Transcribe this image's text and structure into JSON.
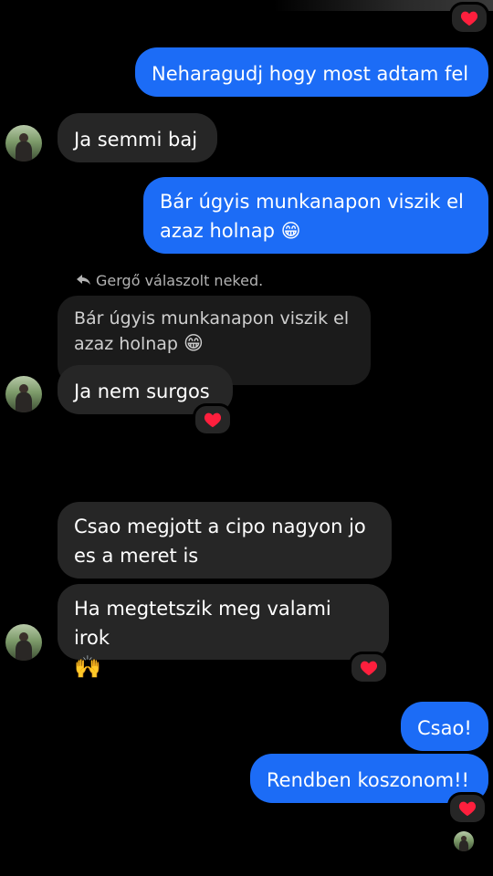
{
  "conversation": {
    "messages": [
      {
        "id": "m1",
        "side": "out",
        "text": "Neharagudj hogy most adtam fel"
      },
      {
        "id": "m2",
        "side": "in",
        "text": "Ja semmi baj"
      },
      {
        "id": "m3",
        "side": "out",
        "text": "Bár úgyis munkanapon viszik el azaz holnap",
        "emoji": "😁"
      },
      {
        "id": "m4",
        "side": "in",
        "reply_label": "Gergő válaszolt neked.",
        "quoted_text": "Bár úgyis munkanapon viszik el azaz holnap",
        "quoted_emoji": "😁",
        "text": "Ja nem surgos",
        "reaction": "heart"
      },
      {
        "id": "m5",
        "side": "in",
        "text": "Csao megjott a cipo nagyon jo es a meret is"
      },
      {
        "id": "m6",
        "side": "in",
        "text": "Ha megtetszik meg valami irok",
        "emoji": "🙌",
        "reaction": "heart"
      },
      {
        "id": "m7",
        "side": "out",
        "text": "Csao!"
      },
      {
        "id": "m8",
        "side": "out",
        "text": "Rendben koszonom!!",
        "reaction": "heart"
      }
    ]
  },
  "colors": {
    "background": "#000000",
    "outgoing_bubble": "#1c6cf6",
    "incoming_bubble": "#262626",
    "quoted_bubble": "#1b1b1b",
    "reaction_heart": "#ff1f3d"
  },
  "icons": {
    "reply": "reply-arrow-icon",
    "reaction": "heart-icon",
    "avatar": "contact-avatar"
  }
}
